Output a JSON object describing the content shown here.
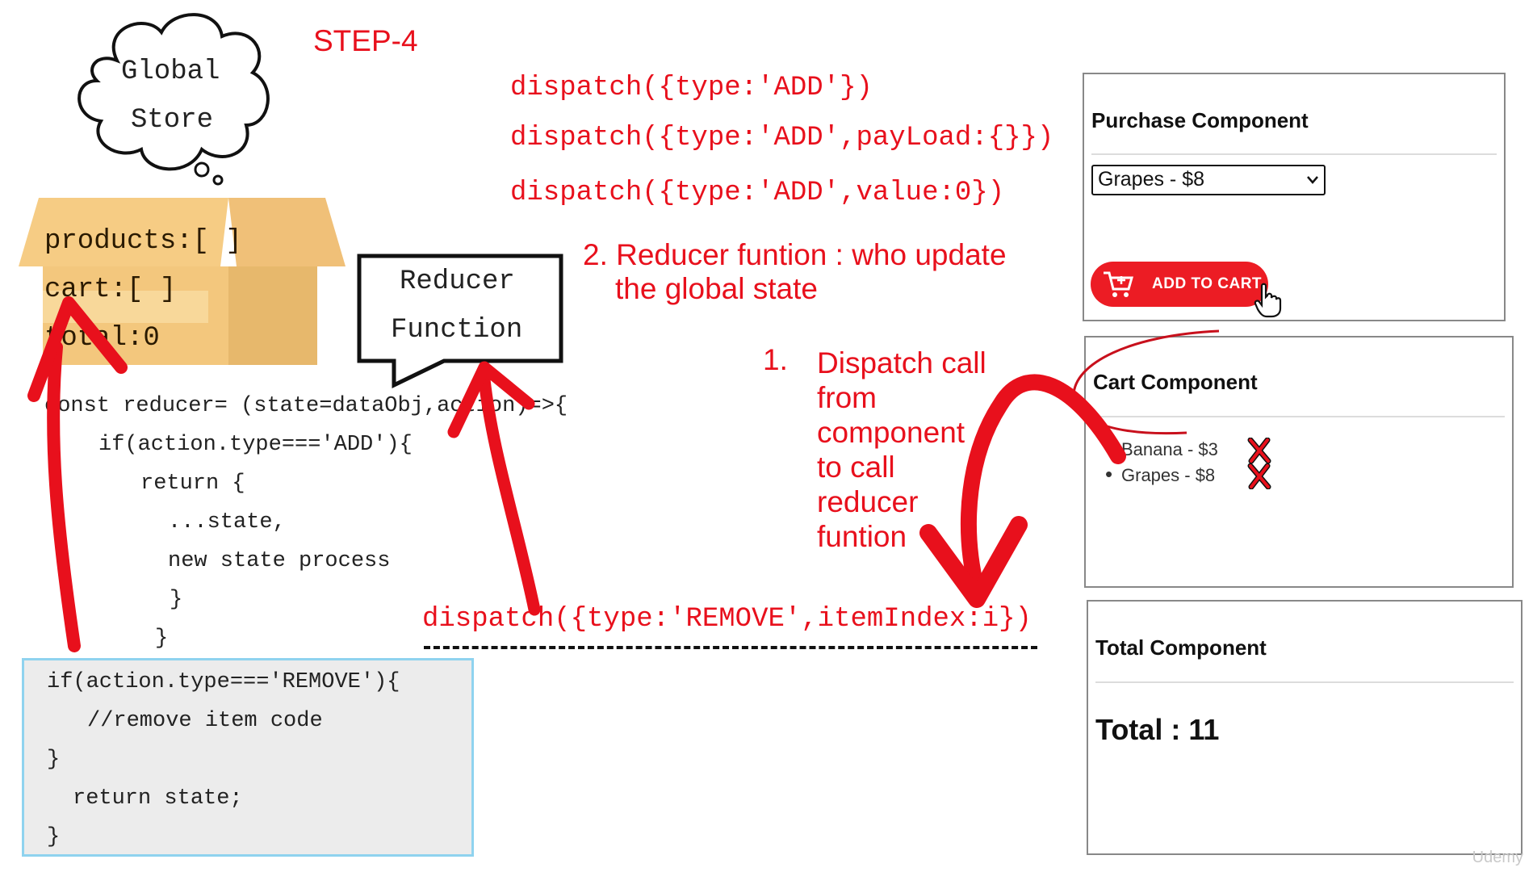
{
  "step_label": "STEP-4",
  "global_store": {
    "line1": "Global",
    "line2": "Store"
  },
  "store_box": {
    "products": "products:[ ]",
    "cart": "cart:[ ]",
    "total": "total:0"
  },
  "reducer_bubble": {
    "line1": "Reducer",
    "line2": "Function"
  },
  "dispatch_examples": [
    "dispatch({type:'ADD'})",
    "dispatch({type:'ADD',payLoad:{}})",
    "dispatch({type:'ADD',value:0})"
  ],
  "note_reducer": {
    "line1": "2. Reducer funtion : who update",
    "line2": "the global state"
  },
  "note_dispatch": {
    "number": "1.",
    "lines": [
      "Dispatch call",
      "from",
      "component",
      "to call",
      "reducer",
      "funtion"
    ]
  },
  "reducer_code": [
    "const reducer= (state=dataObj,action)=>{",
    "if(action.type==='ADD'){",
    "return {",
    "...state,",
    "new state process",
    "}",
    "}"
  ],
  "remove_code": [
    "if(action.type==='REMOVE'){",
    "//remove item code",
    "}",
    "return state;",
    "}"
  ],
  "remove_dispatch": "dispatch({type:'REMOVE',itemIndex:i})",
  "purchase_component": {
    "title": "Purchase Component",
    "select_value": "Grapes - $8",
    "button_label": "ADD TO CART"
  },
  "cart_component": {
    "title": "Cart Component",
    "items": [
      "Banana - $3",
      "Grapes - $8"
    ]
  },
  "total_component": {
    "title": "Total Component",
    "total_text": "Total : 11"
  },
  "watermark": "Udemy",
  "colors": {
    "accent_red": "#e8101c",
    "box_tan": "#f3c77d",
    "code_bg": "#ececec",
    "code_border": "#8fd3ef"
  }
}
